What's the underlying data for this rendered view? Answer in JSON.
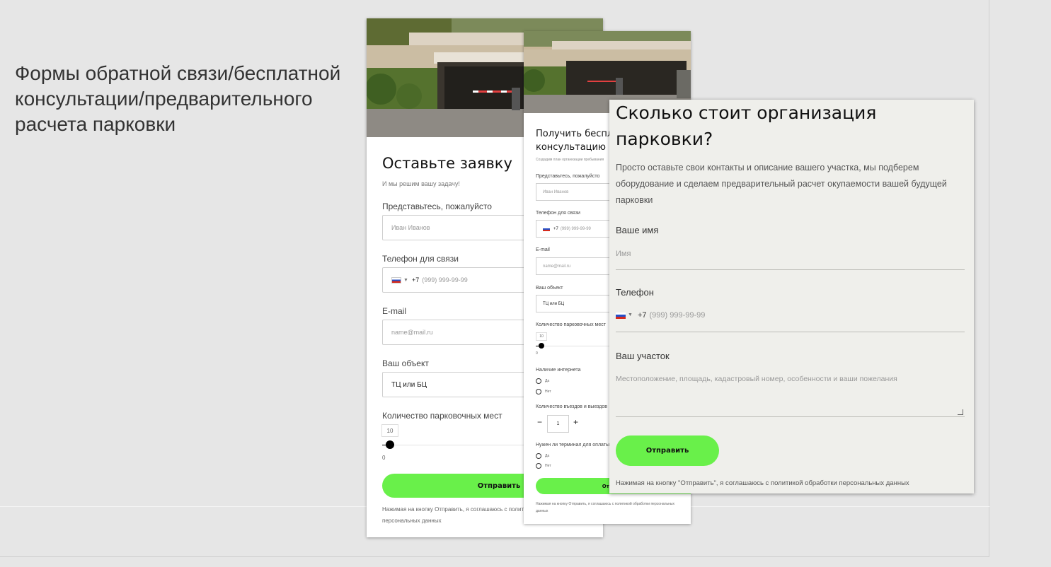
{
  "slide": {
    "title": "Формы обратной связи/бесплатной консультации/предварительного расчета парковки"
  },
  "form1": {
    "title": "Оставьте заявку",
    "subtitle": "И мы решим вашу задачу!",
    "name_label": "Представьтесь, пожалуйсто",
    "name_placeholder": "Иван Иванов",
    "phone_label": "Телефон для связи",
    "phone_code": "+7",
    "phone_placeholder": "(999) 999-99-99",
    "email_label": "E-mail",
    "email_placeholder": "name@mail.ru",
    "object_label": "Ваш объект",
    "object_value": "ТЦ или БЦ",
    "spaces_label": "Количество парковочных мест",
    "slider_value": "10",
    "slider_min": "0",
    "slider_level": 0.05,
    "submit_label": "Отправить",
    "consent": "Нажимая на кнопку Отправить, я соглашаюсь с политикой обработки персональных данных"
  },
  "form2": {
    "title": "Получить бесплатную консультацию",
    "tiny_text": "Создадим план организации пребывания",
    "name_label": "Представьтесь, пожалуйсто",
    "name_placeholder": "Иван Иванов",
    "phone_label": "Телефон для связи",
    "phone_code": "+7",
    "phone_placeholder": "(999) 999-99-99",
    "email_label": "E-mail",
    "email_placeholder": "name@mail.ru",
    "object_label": "Ваш объект",
    "object_value": "ТЦ или БЦ",
    "spaces_label": "Количество парковочных мест",
    "slider_value": "10",
    "slider_min": "0",
    "internet_label": "Наличие интернета",
    "opt_yes": "Да",
    "opt_no": "Нет",
    "entries_label": "Количество въездов и выездов",
    "stepper_minus": "−",
    "stepper_value": "1",
    "stepper_plus": "+",
    "terminal_label": "Нужен ли терминал для оплаты",
    "submit_label": "Отправить",
    "consent": "Нажимая на кнопку Отправить, я соглашаюсь с политикой обработки персональных данных"
  },
  "form3": {
    "title": "Сколько стоит организация парковки?",
    "description": "Просто оставьте свои контакты и описание вашего участка, мы подберем оборудование и сделаем предварительный расчет окупаемости вашей будущей парковки",
    "name_label": "Ваше имя",
    "name_placeholder": "Имя",
    "phone_label": "Телефон",
    "phone_code": "+7",
    "phone_placeholder": "(999) 999-99-99",
    "plot_label": "Ваш участок",
    "plot_placeholder": "Местоположение, площадь, кадастровый номер, особенности и ваши пожелания",
    "submit_label": "Отправить",
    "consent": "Нажимая на кнопку \"Отправить\", я соглашаюсь с политикой обработки персональных данных"
  },
  "colors": {
    "button_green": "#69f04a",
    "slide_background": "#e6e6e6",
    "form3_background": "#efefeb"
  }
}
